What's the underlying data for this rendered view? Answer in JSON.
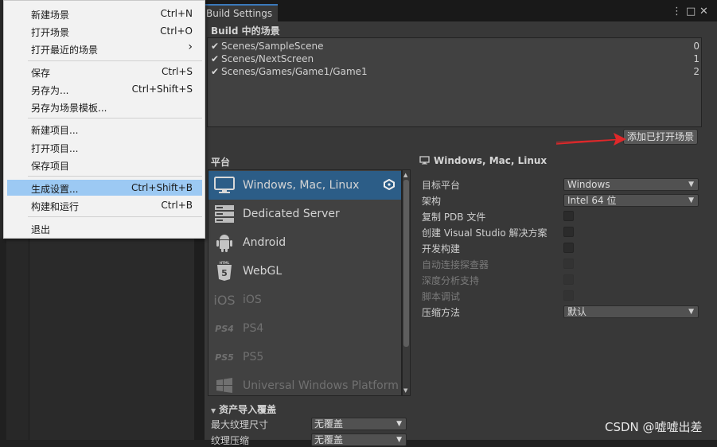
{
  "window": {
    "tab_title": "Build Settings",
    "kebab_icon": "⋮",
    "maximize_icon": "□",
    "close_icon": "✕"
  },
  "scenes": {
    "title": "Build 中的场景",
    "items": [
      {
        "path": "Scenes/SampleScene",
        "index": "0"
      },
      {
        "path": "Scenes/NextScreen",
        "index": "1"
      },
      {
        "path": "Scenes/Games/Game1/Game1",
        "index": "2"
      }
    ],
    "add_button": "添加已打开场景"
  },
  "platform": {
    "title": "平台",
    "items": [
      {
        "label": "Windows, Mac, Linux",
        "icon": "monitor-icon"
      },
      {
        "label": "Dedicated Server",
        "icon": "server-icon"
      },
      {
        "label": "Android",
        "icon": "android-icon"
      },
      {
        "label": "WebGL",
        "icon": "html5-icon"
      },
      {
        "label": "iOS",
        "icon": "ios-icon"
      },
      {
        "label": "PS4",
        "icon": "ps4-icon"
      },
      {
        "label": "PS5",
        "icon": "ps5-icon"
      },
      {
        "label": "Universal Windows Platform",
        "icon": "windows-logo-icon"
      }
    ],
    "icon_glyphs": {
      "ios": "iOS",
      "ps4": "PS4",
      "ps5": "PS5"
    }
  },
  "selected_platform": {
    "title": "Windows, Mac, Linux",
    "target_platform_label": "目标平台",
    "target_platform_value": "Windows",
    "architecture_label": "架构",
    "architecture_value": "Intel 64 位",
    "copy_pdb_label": "复制 PDB 文件",
    "vs_solution_label": "创建 Visual Studio 解决方案",
    "dev_build_label": "开发构建",
    "autoconnect_label": "自动连接探查器",
    "deep_profiling_label": "深度分析支持",
    "script_debug_label": "脚本调试",
    "compression_label": "压缩方法",
    "compression_value": "默认"
  },
  "overrides": {
    "title": "资产导入覆盖",
    "max_texture_label": "最大纹理尺寸",
    "max_texture_value": "无覆盖",
    "texture_compression_label": "纹理压缩",
    "texture_compression_value": "无覆盖"
  },
  "menu": {
    "items": [
      {
        "label": "新建场景",
        "shortcut": "Ctrl+N"
      },
      {
        "label": "打开场景",
        "shortcut": "Ctrl+O"
      },
      {
        "label": "打开最近的场景",
        "shortcut": "›"
      },
      {
        "label": "保存",
        "shortcut": "Ctrl+S"
      },
      {
        "label": "另存为...",
        "shortcut": "Ctrl+Shift+S"
      },
      {
        "label": "另存为场景模板...",
        "shortcut": ""
      },
      {
        "label": "新建项目...",
        "shortcut": ""
      },
      {
        "label": "打开项目...",
        "shortcut": ""
      },
      {
        "label": "保存项目",
        "shortcut": ""
      },
      {
        "label": "生成设置...",
        "shortcut": "Ctrl+Shift+B"
      },
      {
        "label": "构建和运行",
        "shortcut": "Ctrl+B"
      },
      {
        "label": "退出",
        "shortcut": ""
      }
    ],
    "highlighted_index": 9
  },
  "annotation": {
    "arrow_color": "#e0282a"
  },
  "watermark": "CSDN @嘘嘘出差"
}
